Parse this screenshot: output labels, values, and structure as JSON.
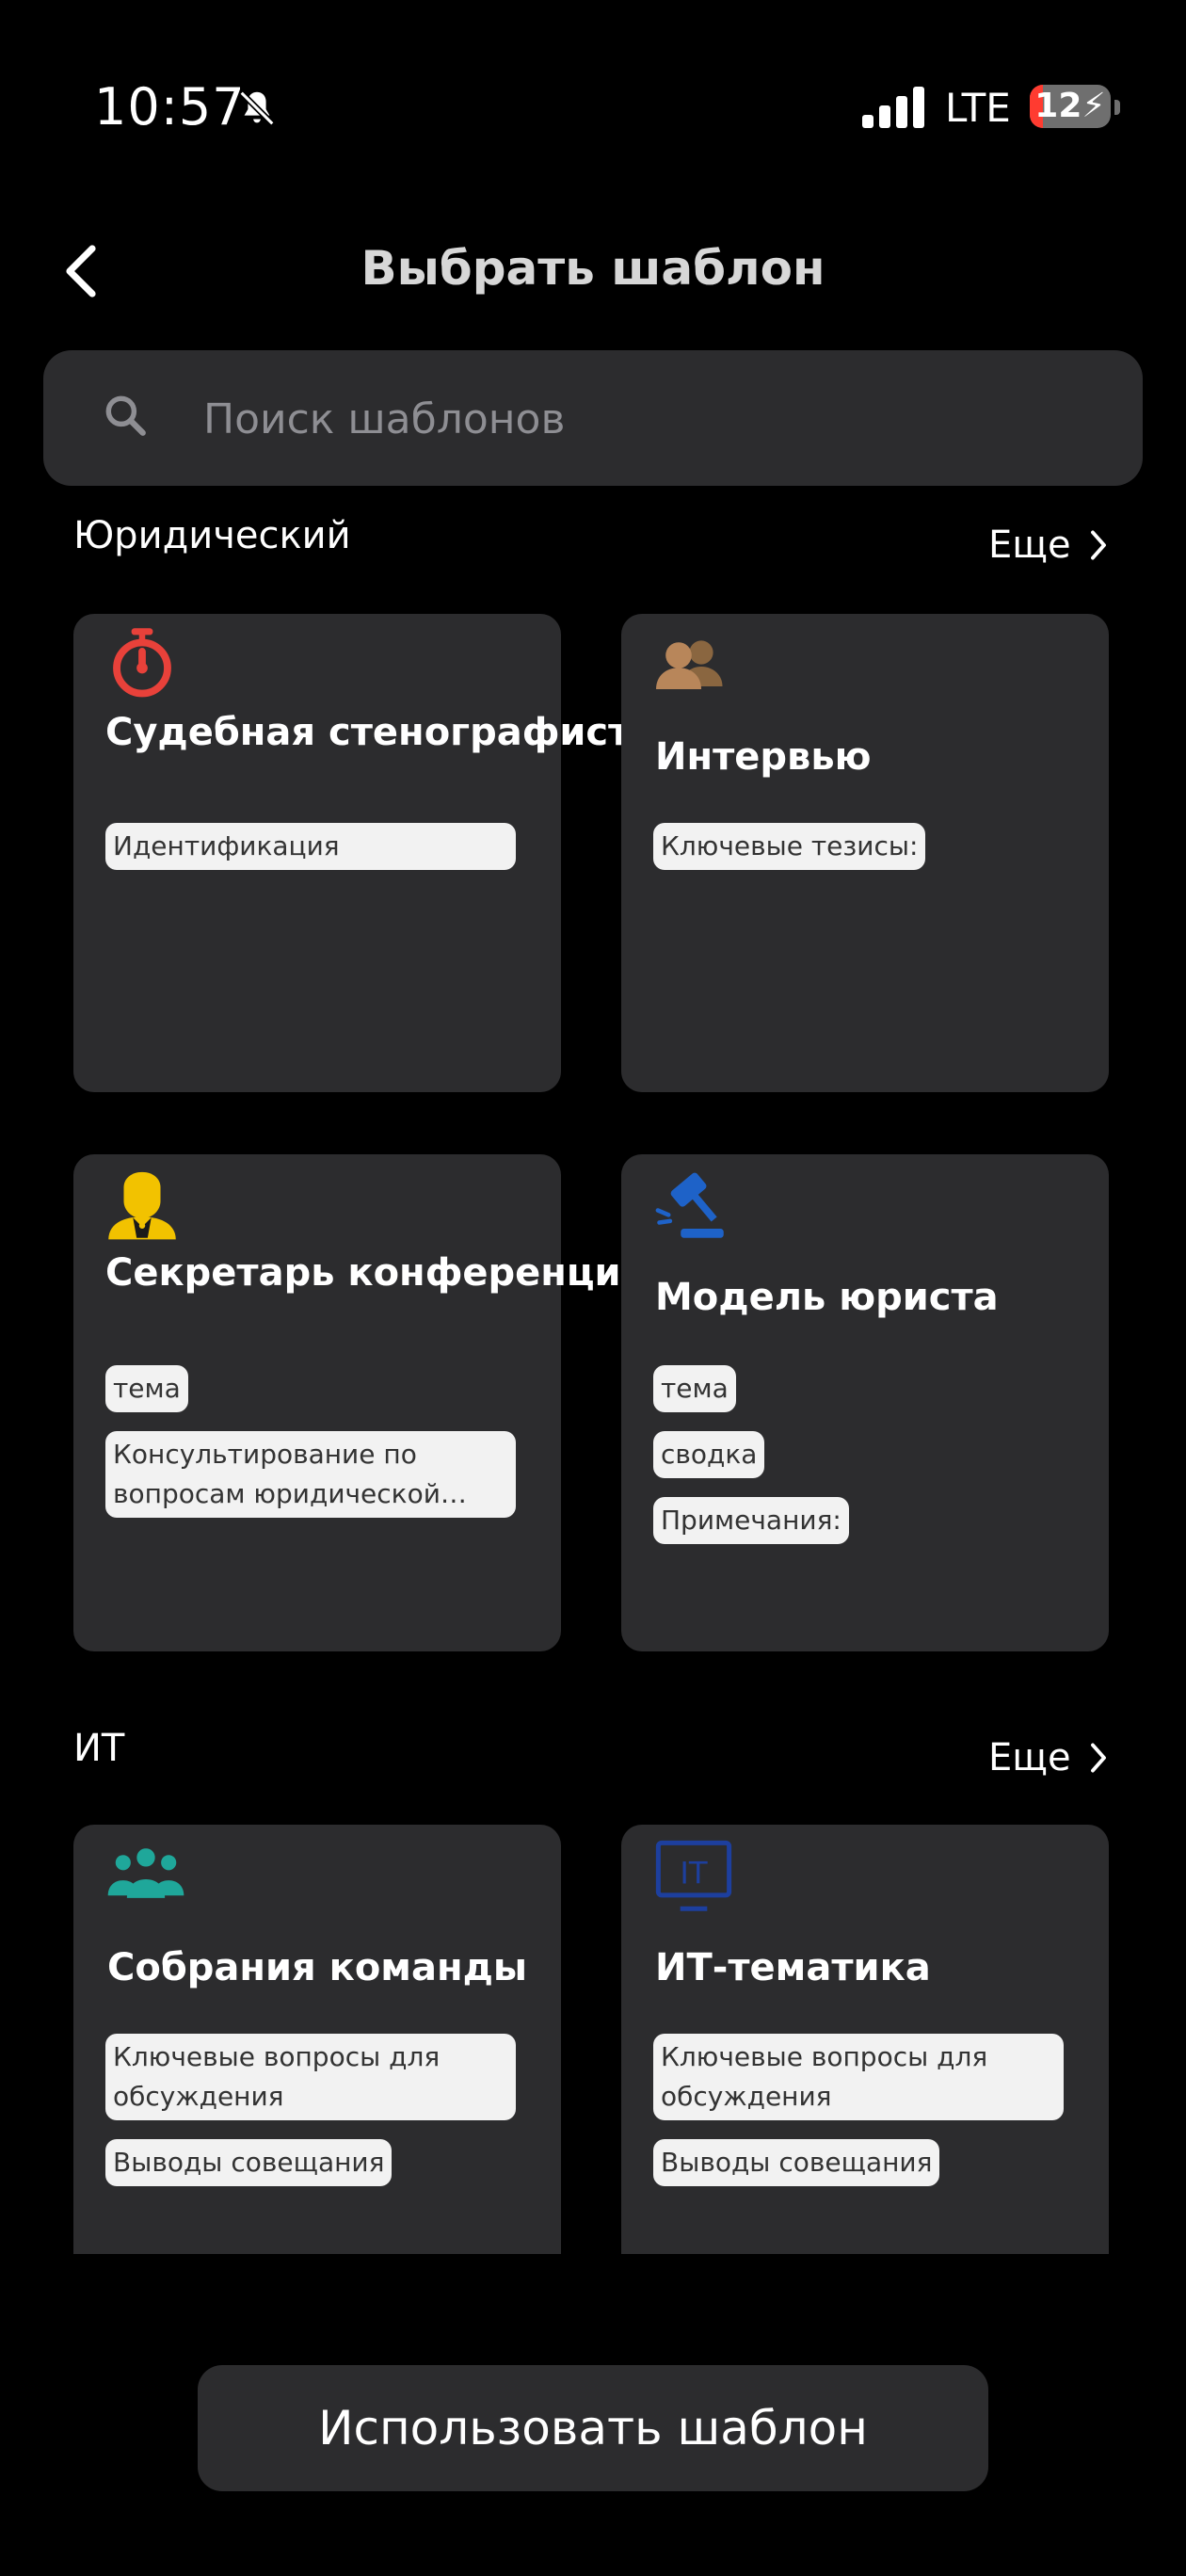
{
  "status_bar": {
    "time": "10:57",
    "network": "LTE",
    "battery": "12",
    "battery_level": 0.12
  },
  "header": {
    "title": "Выбрать шаблон"
  },
  "search": {
    "placeholder": "Поиск шаблонов"
  },
  "sections": [
    {
      "title": "Юридический",
      "more": "Еще",
      "cards": [
        {
          "title": "Судебная стенографистка",
          "tags": [
            "Идентификация"
          ],
          "icon": "stopwatch-icon",
          "color": "#e8413a"
        },
        {
          "title": "Интервью",
          "tags": [
            "Ключевые тезисы:"
          ],
          "icon": "people-icon",
          "color": "#b8865a"
        },
        {
          "title": "Секретарь конференции",
          "tags": [
            "тема",
            "Консультирование по вопросам юридической службы"
          ],
          "icon": "secretary-icon",
          "color": "#f2c200"
        },
        {
          "title": "Модель юриста",
          "tags": [
            "тема",
            "сводка",
            "Примечания:"
          ],
          "icon": "gavel-icon",
          "color": "#1e62c8"
        }
      ]
    },
    {
      "title": "ИТ",
      "more": "Еще",
      "cards": [
        {
          "title": "Собрания команды",
          "tags": [
            "Ключевые вопросы для обсуждения",
            "Выводы совещания"
          ],
          "icon": "team-icon",
          "color": "#1fa79a"
        },
        {
          "title": "ИТ-тематика",
          "tags": [
            "Ключевые вопросы для обсуждения",
            "Выводы совещания"
          ],
          "icon": "it-monitor-icon",
          "color": "#1d3f9e",
          "icon_text": "IT"
        }
      ]
    }
  ],
  "footer": {
    "button_label": "Использовать шаблон"
  }
}
